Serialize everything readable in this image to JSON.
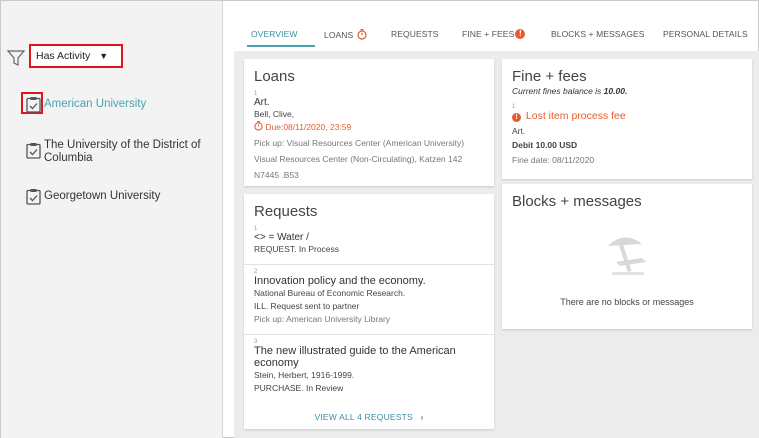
{
  "sidebar": {
    "filter_label": "Has Activity",
    "institutions": [
      {
        "label": "American University"
      },
      {
        "label": "The University of the District of Columbia"
      },
      {
        "label": "Georgetown University"
      }
    ]
  },
  "tabs": [
    {
      "label": "OVERVIEW"
    },
    {
      "label": "LOANS"
    },
    {
      "label": "REQUESTS"
    },
    {
      "label": "FINE + FEES"
    },
    {
      "label": "BLOCKS + MESSAGES"
    },
    {
      "label": "PERSONAL DETAILS"
    }
  ],
  "fees_badge": "!",
  "loans": {
    "title": "Loans",
    "item": {
      "index": "1",
      "title": "Art.",
      "author": "Bell, Clive,",
      "due": "Due:08/11/2020, 23:59",
      "pickup": "Pick up: Visual Resources Center (American University)",
      "location": "Visual Resources Center (Non-Circulating), Katzen 142",
      "call_number": "N7445 .B53"
    }
  },
  "requests": {
    "title": "Requests",
    "items": [
      {
        "index": "1",
        "title": "<> = Water /",
        "lines": [
          "REQUEST. In Process"
        ]
      },
      {
        "index": "2",
        "title": "Innovation policy and the economy.",
        "lines": [
          "National Bureau of Economic Research.",
          "ILL. Request sent to partner"
        ],
        "pickup": "Pick up: American University Library"
      },
      {
        "index": "3",
        "title": "The new illustrated guide to the American economy",
        "lines": [
          "Stein, Herbert, 1916-1999.",
          "PURCHASE. In Review"
        ]
      }
    ],
    "view_all": "VIEW ALL 4 REQUESTS"
  },
  "fines": {
    "title": "Fine + fees",
    "balance_prefix": "Current fines balance is ",
    "balance_value": "10.00.",
    "item": {
      "index": "1",
      "type": "Lost item process fee",
      "title": "Art.",
      "debit": "Debit 10.00 USD",
      "date": "Fine date: 08/11/2020"
    }
  },
  "blocks": {
    "title": "Blocks + messages",
    "empty": "There are no blocks or messages"
  },
  "colors": {
    "accent": "#4aa3b3",
    "alert": "#e95b2d",
    "highlight_box": "#e0141b"
  }
}
